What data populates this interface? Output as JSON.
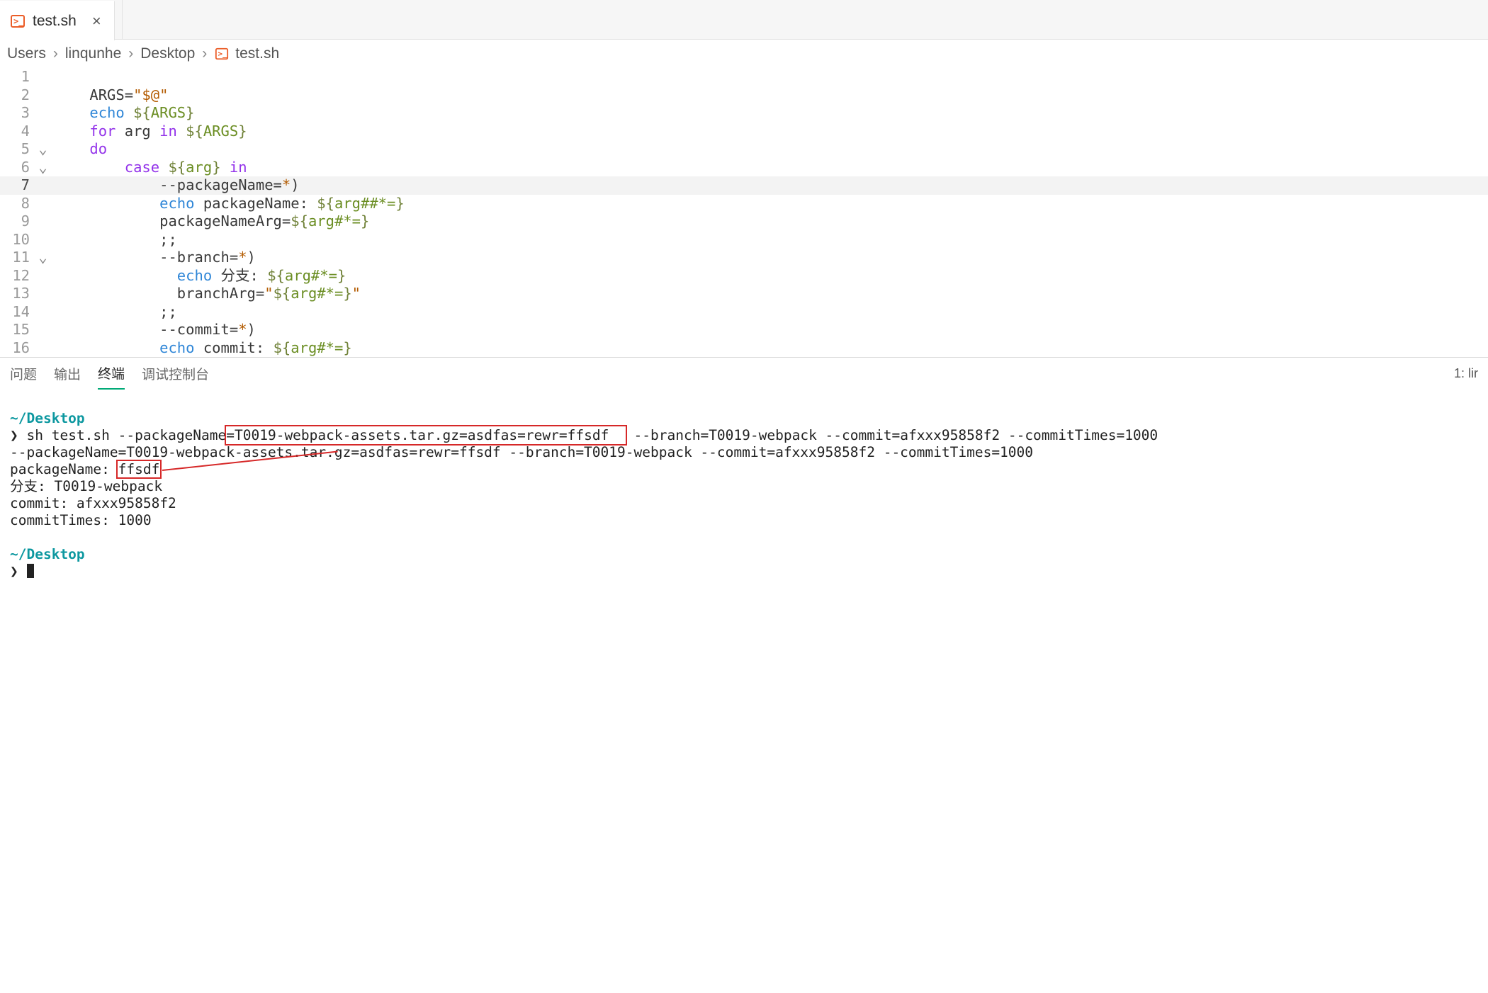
{
  "tab": {
    "filename": "test.sh",
    "close_glyph": "×"
  },
  "breadcrumbs": {
    "items": [
      "Users",
      "linqunhe",
      "Desktop",
      "test.sh"
    ],
    "sep": "›"
  },
  "fold_glyph": "⌄",
  "editor_lines": [
    {
      "n": 1,
      "fold": "",
      "hl": false,
      "tokens": []
    },
    {
      "n": 2,
      "fold": "",
      "hl": false,
      "tokens": [
        {
          "t": "ARGS",
          "c": "tok-var",
          "pre": "    "
        },
        {
          "t": "=",
          "c": "tok-op"
        },
        {
          "t": "\"$@\"",
          "c": "tok-str"
        }
      ]
    },
    {
      "n": 3,
      "fold": "",
      "hl": false,
      "tokens": [
        {
          "t": "echo",
          "c": "tok-cmd",
          "pre": "    "
        },
        {
          "t": " ",
          "c": ""
        },
        {
          "t": "${",
          "c": "tok-paramdelim"
        },
        {
          "t": "ARGS",
          "c": "tok-param"
        },
        {
          "t": "}",
          "c": "tok-paramdelim"
        }
      ]
    },
    {
      "n": 4,
      "fold": "",
      "hl": false,
      "tokens": [
        {
          "t": "for",
          "c": "tok-kw",
          "pre": "    "
        },
        {
          "t": " arg ",
          "c": "tok-plain"
        },
        {
          "t": "in",
          "c": "tok-kw"
        },
        {
          "t": " ",
          "c": ""
        },
        {
          "t": "${",
          "c": "tok-paramdelim"
        },
        {
          "t": "ARGS",
          "c": "tok-param"
        },
        {
          "t": "}",
          "c": "tok-paramdelim"
        }
      ]
    },
    {
      "n": 5,
      "fold": "⌄",
      "hl": false,
      "tokens": [
        {
          "t": "do",
          "c": "tok-kw",
          "pre": "    "
        }
      ]
    },
    {
      "n": 6,
      "fold": "⌄",
      "hl": false,
      "tokens": [
        {
          "t": "case",
          "c": "tok-kw",
          "pre": "        "
        },
        {
          "t": " ",
          "c": ""
        },
        {
          "t": "${",
          "c": "tok-paramdelim"
        },
        {
          "t": "arg",
          "c": "tok-param"
        },
        {
          "t": "}",
          "c": "tok-paramdelim"
        },
        {
          "t": " ",
          "c": ""
        },
        {
          "t": "in",
          "c": "tok-kw"
        }
      ]
    },
    {
      "n": 7,
      "fold": "",
      "hl": true,
      "tokens": [
        {
          "t": "--packageName=",
          "c": "tok-plain",
          "pre": "            "
        },
        {
          "t": "*",
          "c": "tok-str"
        },
        {
          "t": ")",
          "c": "tok-punc"
        }
      ]
    },
    {
      "n": 8,
      "fold": "",
      "hl": false,
      "tokens": [
        {
          "t": "echo",
          "c": "tok-cmd",
          "pre": "            "
        },
        {
          "t": " packageName: ",
          "c": "tok-plain"
        },
        {
          "t": "${",
          "c": "tok-paramdelim"
        },
        {
          "t": "arg",
          "c": "tok-param"
        },
        {
          "t": "##*=",
          "c": "tok-param"
        },
        {
          "t": "}",
          "c": "tok-paramdelim"
        }
      ]
    },
    {
      "n": 9,
      "fold": "",
      "hl": false,
      "tokens": [
        {
          "t": "packageNameArg",
          "c": "tok-var",
          "pre": "            "
        },
        {
          "t": "=",
          "c": "tok-op"
        },
        {
          "t": "${",
          "c": "tok-paramdelim"
        },
        {
          "t": "arg",
          "c": "tok-param"
        },
        {
          "t": "#*=",
          "c": "tok-param"
        },
        {
          "t": "}",
          "c": "tok-paramdelim"
        }
      ]
    },
    {
      "n": 10,
      "fold": "",
      "hl": false,
      "tokens": [
        {
          "t": ";;",
          "c": "tok-punc",
          "pre": "            "
        }
      ]
    },
    {
      "n": 11,
      "fold": "⌄",
      "hl": false,
      "tokens": [
        {
          "t": "--branch=",
          "c": "tok-plain",
          "pre": "            "
        },
        {
          "t": "*",
          "c": "tok-str"
        },
        {
          "t": ")",
          "c": "tok-punc"
        }
      ]
    },
    {
      "n": 12,
      "fold": "",
      "hl": false,
      "tokens": [
        {
          "t": "echo",
          "c": "tok-cmd",
          "pre": "              "
        },
        {
          "t": " 分支: ",
          "c": "tok-plain"
        },
        {
          "t": "${",
          "c": "tok-paramdelim"
        },
        {
          "t": "arg",
          "c": "tok-param"
        },
        {
          "t": "#*=",
          "c": "tok-param"
        },
        {
          "t": "}",
          "c": "tok-paramdelim"
        }
      ]
    },
    {
      "n": 13,
      "fold": "",
      "hl": false,
      "tokens": [
        {
          "t": "branchArg",
          "c": "tok-var",
          "pre": "              "
        },
        {
          "t": "=",
          "c": "tok-op"
        },
        {
          "t": "\"",
          "c": "tok-str"
        },
        {
          "t": "${",
          "c": "tok-paramdelim"
        },
        {
          "t": "arg",
          "c": "tok-param"
        },
        {
          "t": "#*=",
          "c": "tok-param"
        },
        {
          "t": "}",
          "c": "tok-paramdelim"
        },
        {
          "t": "\"",
          "c": "tok-str"
        }
      ]
    },
    {
      "n": 14,
      "fold": "",
      "hl": false,
      "tokens": [
        {
          "t": ";;",
          "c": "tok-punc",
          "pre": "            "
        }
      ]
    },
    {
      "n": 15,
      "fold": "",
      "hl": false,
      "tokens": [
        {
          "t": "--commit=",
          "c": "tok-plain",
          "pre": "            "
        },
        {
          "t": "*",
          "c": "tok-str"
        },
        {
          "t": ")",
          "c": "tok-punc"
        }
      ]
    },
    {
      "n": 16,
      "fold": "",
      "hl": false,
      "tokens": [
        {
          "t": "echo",
          "c": "tok-cmd",
          "pre": "            "
        },
        {
          "t": " commit: ",
          "c": "tok-plain"
        },
        {
          "t": "${",
          "c": "tok-paramdelim"
        },
        {
          "t": "arg",
          "c": "tok-param"
        },
        {
          "t": "#*=",
          "c": "tok-param"
        },
        {
          "t": "}",
          "c": "tok-paramdelim"
        }
      ]
    }
  ],
  "panel": {
    "tabs": {
      "problems": "问题",
      "output": "输出",
      "terminal": "终端",
      "debug": "调试控制台"
    },
    "right_label": "1: lir"
  },
  "terminal": {
    "cwd1": "~/Desktop",
    "prompt": "❯",
    "cmd_pre": "sh test.sh --packageName",
    "cmd_boxed": "=T0019-webpack-assets.tar.gz=asdfas=rewr=ffsdf  ",
    "cmd_post": " --branch=T0019-webpack --commit=afxxx95858f2 --commitTimes=1000",
    "out1": "--packageName=T0019-webpack-assets.tar.gz=asdfas=rewr=ffsdf --branch=T0019-webpack --commit=afxxx95858f2 --commitTimes=1000",
    "out2_pre": "packageName: ",
    "out2_boxed": "ffsdf",
    "out3": "分支: T0019-webpack",
    "out4": "commit: afxxx95858f2",
    "out5": "commitTimes: 1000",
    "cwd2": "~/Desktop"
  }
}
